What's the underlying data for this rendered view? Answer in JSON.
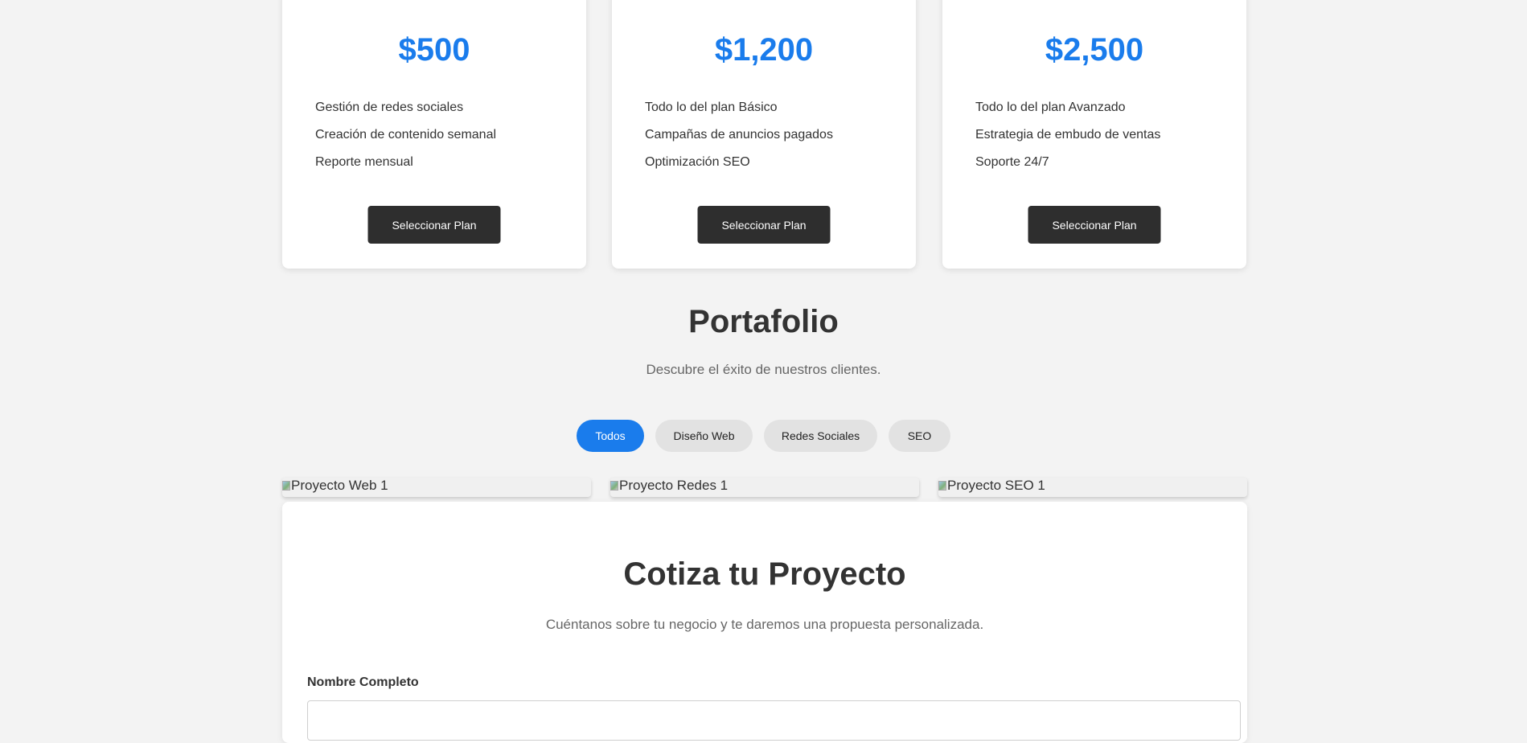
{
  "plans": [
    {
      "price": "$500",
      "features": [
        "Gestión de redes sociales",
        "Creación de contenido semanal",
        "Reporte mensual"
      ],
      "button_label": "Seleccionar Plan"
    },
    {
      "price": "$1,200",
      "features": [
        "Todo lo del plan Básico",
        "Campañas de anuncios pagados",
        "Optimización SEO"
      ],
      "button_label": "Seleccionar Plan"
    },
    {
      "price": "$2,500",
      "features": [
        "Todo lo del plan Avanzado",
        "Estrategia de embudo de ventas",
        "Soporte 24/7"
      ],
      "button_label": "Seleccionar Plan"
    }
  ],
  "portfolio": {
    "title": "Portafolio",
    "subtitle": "Descubre el éxito de nuestros clientes.",
    "filters": [
      "Todos",
      "Diseño Web",
      "Redes Sociales",
      "SEO"
    ],
    "active_filter": "Todos",
    "projects": [
      "Proyecto Web 1",
      "Proyecto Redes 1",
      "Proyecto SEO 1"
    ]
  },
  "quote": {
    "title": "Cotiza tu Proyecto",
    "subtitle": "Cuéntanos sobre tu negocio y te daremos una propuesta personalizada.",
    "name_label": "Nombre Completo",
    "name_value": ""
  },
  "colors": {
    "accent": "#1a7cec",
    "button_dark": "#2e2e2e",
    "background": "#f3f3f3"
  }
}
